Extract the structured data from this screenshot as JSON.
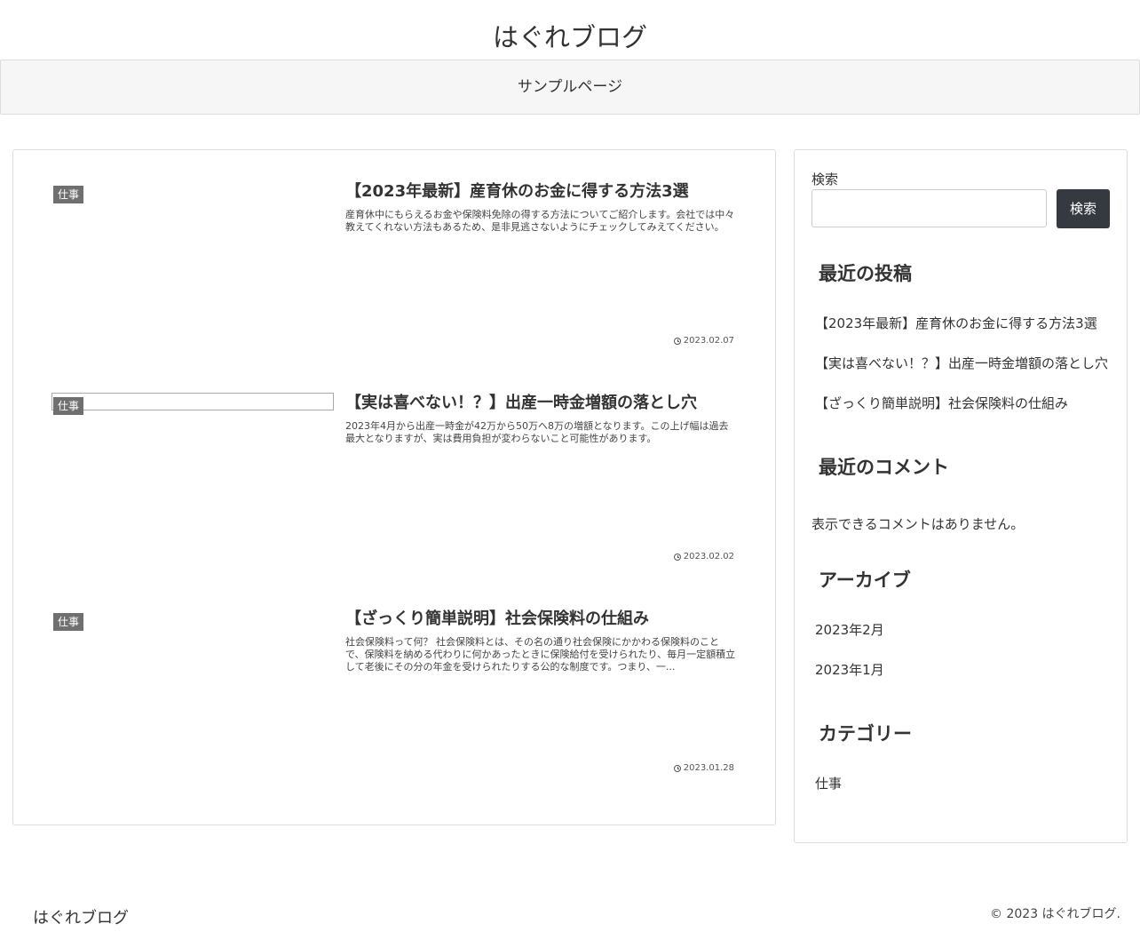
{
  "site": {
    "title": "はぐれブログ"
  },
  "nav": {
    "items": [
      {
        "label": "サンプルページ"
      }
    ]
  },
  "posts": [
    {
      "category": "仕事",
      "title": "【2023年最新】産育休のお金に得する方法3選",
      "snippet": "産育休中にもらえるお金や保険料免除の得する方法についてご紹介します。会社では中々教えてくれない方法もあるため、是非見逃さないようにチェックしてみえてください。",
      "date": "2023.02.07"
    },
    {
      "category": "仕事",
      "title": "【実は喜べない！？】出産一時金増額の落とし穴",
      "snippet": "2023年4月から出産一時金が42万から50万へ8万の増額となります。この上げ幅は過去最大となりますが、実は費用負担が変わらないこと可能性があります。",
      "date": "2023.02.02"
    },
    {
      "category": "仕事",
      "title": "【ざっくり簡単説明】社会保険料の仕組み",
      "snippet": "社会保険料って何？ 社会保険料とは、その名の通り社会保険にかかわる保険料のことで、保険料を納める代わりに何かあったときに保険給付を受けられたり、毎月一定額積立して老後にその分の年金を受けられたりする公的な制度です。つまり、一...",
      "date": "2023.01.28"
    }
  ],
  "sidebar": {
    "search": {
      "label": "検索",
      "button": "検索",
      "value": ""
    },
    "recent_posts": {
      "title": "最近の投稿",
      "items": [
        "【2023年最新】産育休のお金に得する方法3選",
        "【実は喜べない！？】出産一時金増額の落とし穴",
        "【ざっくり簡単説明】社会保険料の仕組み"
      ]
    },
    "recent_comments": {
      "title": "最近のコメント",
      "empty": "表示できるコメントはありません。"
    },
    "archives": {
      "title": "アーカイブ",
      "items": [
        "2023年2月",
        "2023年1月"
      ]
    },
    "categories": {
      "title": "カテゴリー",
      "items": [
        "仕事"
      ]
    }
  },
  "footer": {
    "title": "はぐれブログ",
    "copyright": "© 2023 はぐれブログ."
  },
  "icons": {
    "date": "clock-icon"
  },
  "colors": {
    "button_bg": "#343a40",
    "category_bg": "#6f6f6f",
    "nav_bg": "#f6f6f6"
  }
}
